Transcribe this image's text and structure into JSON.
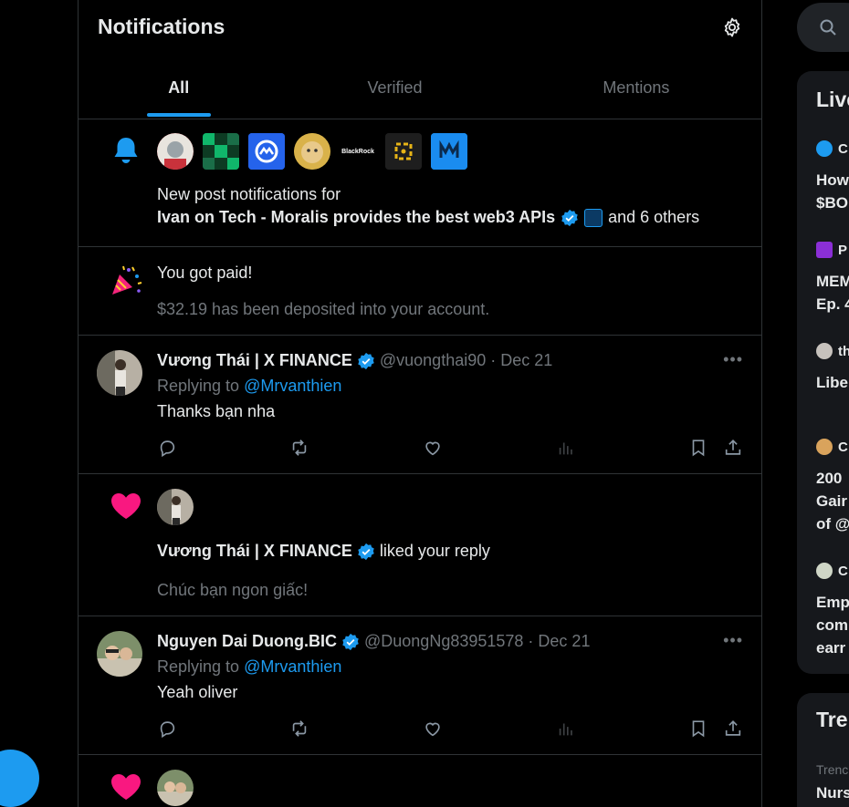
{
  "header": {
    "title": "Notifications"
  },
  "tabs": [
    {
      "label": "All",
      "active": true
    },
    {
      "label": "Verified",
      "active": false
    },
    {
      "label": "Mentions",
      "active": false
    }
  ],
  "post_notification": {
    "line1": "New post notifications for",
    "account_name": "Ivan on Tech - Moralis provides the best web3 APIs",
    "others": "and 6 others",
    "avatar_labels": {
      "blackrock": "BlackRock"
    }
  },
  "payment": {
    "title": "You got paid!",
    "detail": "$32.19 has been deposited into your account."
  },
  "tweet1": {
    "name": "Vương Thái | X FINANCE",
    "handle": "@vuongthai90",
    "sep": "·",
    "date": "Dec 21",
    "replying_prefix": "Replying to",
    "replying_to": "@Mrvanthien",
    "text": "Thanks bạn nha"
  },
  "liked1": {
    "name": "Vương Thái | X FINANCE",
    "action": "liked your reply",
    "quote": "Chúc bạn ngon giấc!"
  },
  "tweet2": {
    "name": "Nguyen Dai Duong.BIC",
    "handle": "@DuongNg83951578",
    "sep": "·",
    "date": "Dec 21",
    "replying_prefix": "Replying to",
    "replying_to": "@Mrvanthien",
    "text": "Yeah oliver"
  },
  "sidebar": {
    "live_title": "Live",
    "live_items": [
      {
        "source": "C",
        "text": [
          "How",
          "$BO"
        ]
      },
      {
        "source": "P",
        "text": [
          "MEM",
          "Ep. 4"
        ]
      },
      {
        "source": "th",
        "text": [
          "Libe"
        ]
      },
      {
        "source": "C",
        "text": [
          "200",
          "Gair",
          "of @"
        ]
      },
      {
        "source": "C",
        "text": [
          "Emp",
          "com",
          "earr"
        ]
      }
    ],
    "trends_title": "Tre",
    "trend_sub": "Trenc",
    "trend_text": "Nurs"
  },
  "colors": {
    "accent": "#1d9bf0",
    "like": "#f91880",
    "muted": "#71767b",
    "border": "#2f3336"
  }
}
